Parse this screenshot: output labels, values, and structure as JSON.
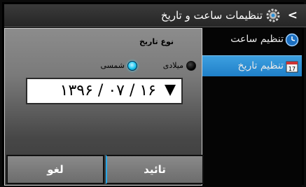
{
  "title": {
    "text": "تنظیمات ساعت و تاریخ",
    "back_icon": "chevron-left-icon",
    "settings_icon": "gear-icon"
  },
  "menu": {
    "items": [
      {
        "label": "تنظیم ساعت",
        "icon": "clock-icon",
        "active": false
      },
      {
        "label": "تنظیم تاریخ",
        "icon": "calendar-icon",
        "active": true
      }
    ]
  },
  "dialog": {
    "date_type_label": "نوع تاریخ",
    "radio_miladi": "میلادی",
    "radio_shamsi": "شمسی",
    "selected": "شمسی",
    "date_value": "۱۳۹۶ / ۰۷ / ۱۶",
    "ok_label": "تائید",
    "cancel_label": "لغو"
  },
  "colors": {
    "accent": "#2a90d8",
    "radio_selected": "#17c5ef"
  }
}
